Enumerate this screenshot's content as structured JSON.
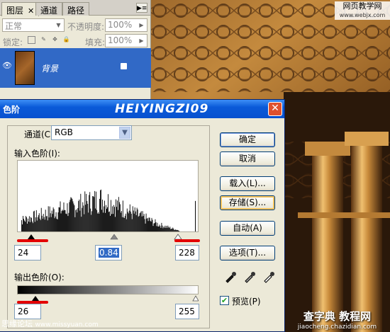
{
  "layers_panel": {
    "tabs": [
      {
        "label": "图层",
        "close": "✕"
      },
      {
        "label": "通道"
      },
      {
        "label": "路径"
      }
    ],
    "menu_icon": "triangle-menu-icon",
    "blend_mode": "正常",
    "opacity_label": "不透明度:",
    "opacity_value": "100%",
    "lock_label": "锁定:",
    "fill_label": "填充:",
    "fill_value": "100%",
    "layer": {
      "name": "背景",
      "visible": true,
      "locked": true
    }
  },
  "watermarks": {
    "top_right_main": "网页教学网",
    "top_right_sub": "www.webjx.com",
    "bottom_left_main": "思缘论坛",
    "bottom_left_sub": "www.missyuan.com",
    "bottom_right_main": "查字典 教程网",
    "bottom_right_sub": "jiaocheng.chazidian.com"
  },
  "dialog": {
    "title": "色阶",
    "brand": "HEIYINGZI09",
    "close_label": "✕",
    "channel_label": "通道(C):",
    "channel_value": "RGB",
    "input_label": "输入色阶(I):",
    "input_black": "24",
    "input_mid": "0.84",
    "input_white": "228",
    "output_label": "输出色阶(O):",
    "output_black": "26",
    "output_white": "255",
    "buttons": {
      "ok": "确定",
      "cancel": "取消",
      "load": "载入(L)...",
      "save": "存储(S)...",
      "auto": "自动(A)",
      "options": "选项(T)..."
    },
    "preview_label": "预览(P)",
    "preview_checked": true,
    "accent_color": "#e30000",
    "title_color": "#0a5ad8"
  }
}
